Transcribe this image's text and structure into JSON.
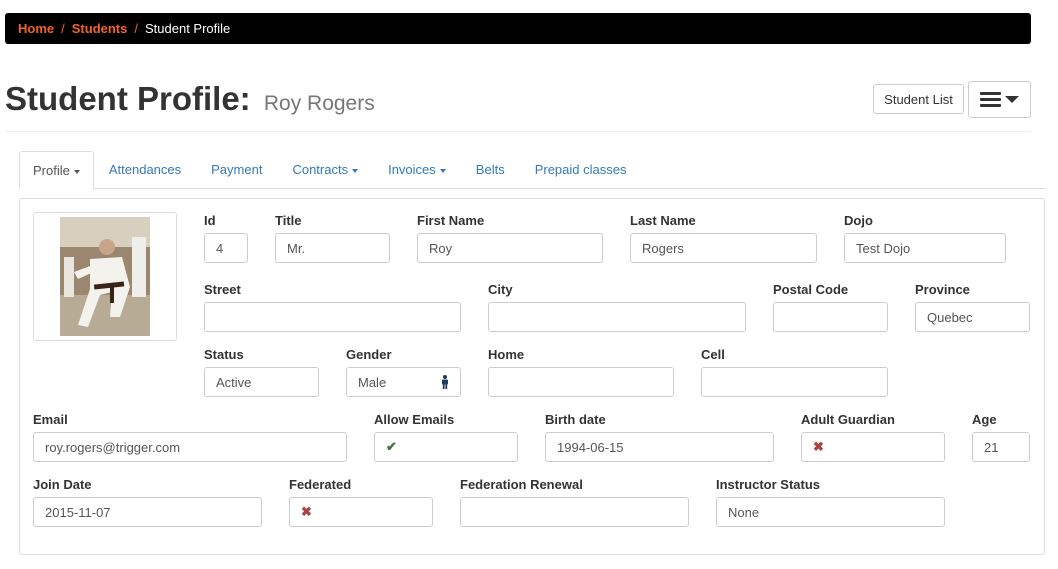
{
  "breadcrumb": {
    "home": "Home",
    "students": "Students",
    "separator": "/",
    "current": "Student Profile"
  },
  "header": {
    "title": "Student Profile:",
    "student_name": "Roy Rogers",
    "student_list_button": "Student List",
    "menu_icon": "hamburger-menu-icon"
  },
  "tabs": [
    {
      "label": "Profile",
      "dropdown": true,
      "active": true
    },
    {
      "label": "Attendances",
      "dropdown": false
    },
    {
      "label": "Payment",
      "dropdown": false
    },
    {
      "label": "Contracts",
      "dropdown": true
    },
    {
      "label": "Invoices",
      "dropdown": true
    },
    {
      "label": "Belts",
      "dropdown": false
    },
    {
      "label": "Prepaid classes",
      "dropdown": false
    }
  ],
  "profile": {
    "photo_icon": "student-photo",
    "id": {
      "label": "Id",
      "value": "4"
    },
    "title": {
      "label": "Title",
      "value": "Mr."
    },
    "first_name": {
      "label": "First Name",
      "value": "Roy"
    },
    "last_name": {
      "label": "Last Name",
      "value": "Rogers"
    },
    "dojo": {
      "label": "Dojo",
      "value": "Test Dojo"
    },
    "street": {
      "label": "Street",
      "value": ""
    },
    "city": {
      "label": "City",
      "value": ""
    },
    "postal_code": {
      "label": "Postal Code",
      "value": ""
    },
    "province": {
      "label": "Province",
      "value": "Quebec"
    },
    "status": {
      "label": "Status",
      "value": "Active"
    },
    "gender": {
      "label": "Gender",
      "value": "Male",
      "icon": "male-icon"
    },
    "home": {
      "label": "Home",
      "value": ""
    },
    "cell": {
      "label": "Cell",
      "value": ""
    },
    "email": {
      "label": "Email",
      "value": "roy.rogers@trigger.com"
    },
    "allow_emails": {
      "label": "Allow Emails",
      "value": true,
      "icon": "checkmark-icon"
    },
    "birth_date": {
      "label": "Birth date",
      "value": "1994-06-15"
    },
    "adult_guardian": {
      "label": "Adult Guardian",
      "value": false,
      "icon": "cross-icon"
    },
    "age": {
      "label": "Age",
      "value": "21"
    },
    "join_date": {
      "label": "Join Date",
      "value": "2015-11-07"
    },
    "federated": {
      "label": "Federated",
      "value": false,
      "icon": "cross-icon"
    },
    "federation_renewal": {
      "label": "Federation Renewal",
      "value": ""
    },
    "instructor_status": {
      "label": "Instructor Status",
      "value": "None"
    }
  },
  "colors": {
    "accent": "#f0642b",
    "link": "#337ab7",
    "check": "#3c763d",
    "cross": "#a94442",
    "male_icon": "#1f3a5c"
  }
}
